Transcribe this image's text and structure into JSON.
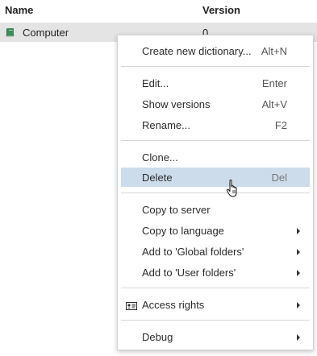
{
  "table": {
    "headers": {
      "name": "Name",
      "version": "Version"
    },
    "row": {
      "icon": "book-icon",
      "name": "Computer",
      "version": "0"
    }
  },
  "context_menu": {
    "highlighted_item": "Delete",
    "groups": [
      [
        {
          "label": "Create new dictionary...",
          "shortcut": "Alt+N"
        }
      ],
      [
        {
          "label": "Edit...",
          "shortcut": "Enter"
        },
        {
          "label": "Show versions",
          "shortcut": "Alt+V"
        },
        {
          "label": "Rename...",
          "shortcut": "F2"
        }
      ],
      [
        {
          "label": "Clone...",
          "shortcut": ""
        },
        {
          "label": "Delete",
          "shortcut": "Del"
        }
      ],
      [
        {
          "label": "Copy to server",
          "shortcut": ""
        },
        {
          "label": "Copy to language",
          "submenu": true
        },
        {
          "label": "Add to 'Global folders'",
          "submenu": true
        },
        {
          "label": "Add to 'User folders'",
          "submenu": true
        }
      ],
      [
        {
          "label": "Access rights",
          "submenu": true,
          "icon": "id-card-icon"
        }
      ],
      [
        {
          "label": "Debug",
          "submenu": true
        }
      ]
    ]
  },
  "colors": {
    "row_background": "#e4e4e4",
    "highlight_background": "#cddcea",
    "book_icon": "#3c8d5a"
  },
  "cursor": "hand-pointer-icon"
}
